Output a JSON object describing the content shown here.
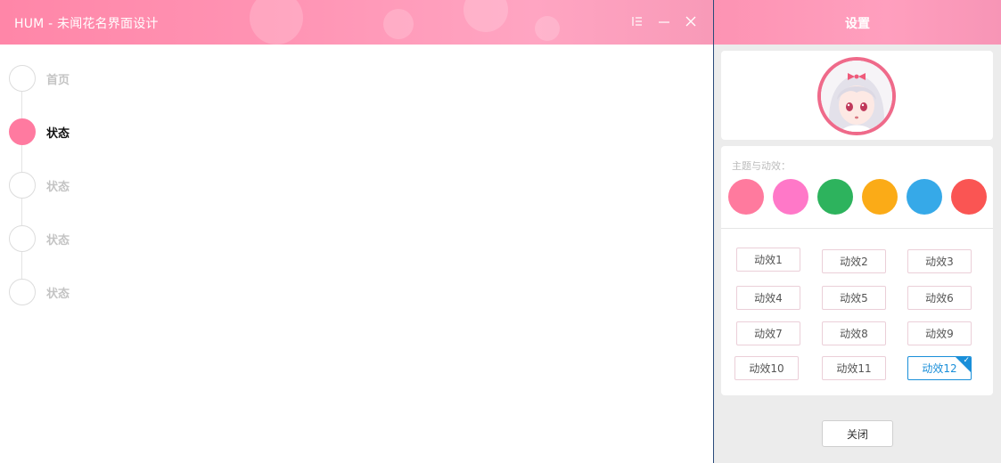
{
  "window": {
    "title": "HUM - 未闻花名界面设计",
    "controls": {
      "menu": "menu-icon",
      "minimize": "minimize-icon",
      "close": "close-icon"
    }
  },
  "timeline": {
    "items": [
      {
        "label": "首页",
        "active": false
      },
      {
        "label": "状态",
        "active": true
      },
      {
        "label": "状态",
        "active": false
      },
      {
        "label": "状态",
        "active": false
      },
      {
        "label": "状态",
        "active": false
      }
    ]
  },
  "settings": {
    "title": "设置",
    "theme_label": "主题与动效：",
    "swatches": [
      "#ff7a9e",
      "#ff78c8",
      "#2db35d",
      "#fbab17",
      "#36a9e8",
      "#fa5553"
    ],
    "effects": [
      {
        "label": "动效1"
      },
      {
        "label": "动效2"
      },
      {
        "label": "动效3"
      },
      {
        "label": "动效4"
      },
      {
        "label": "动效5"
      },
      {
        "label": "动效6"
      },
      {
        "label": "动效7"
      },
      {
        "label": "动效8"
      },
      {
        "label": "动效9"
      },
      {
        "label": "动效10"
      },
      {
        "label": "动效11"
      },
      {
        "label": "动效12",
        "selected": true
      }
    ],
    "close_label": "关闭"
  },
  "colors": {
    "accent": "#ff7aa0",
    "selected": "#1a8fd9",
    "avatar_ring": "#ef6a8a"
  }
}
